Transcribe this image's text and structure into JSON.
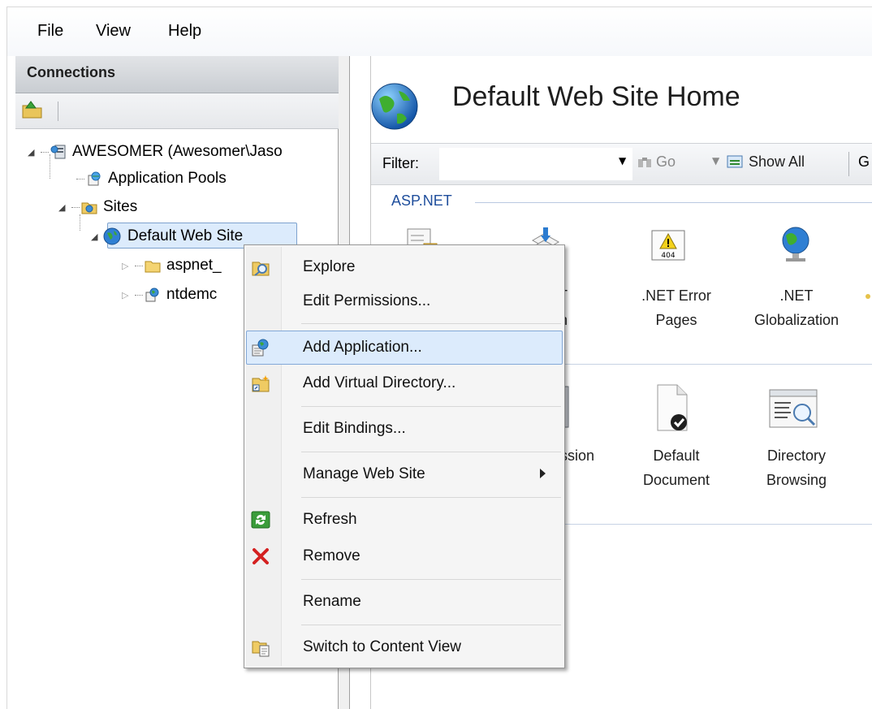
{
  "menubar": {
    "file": "File",
    "view": "View",
    "help": "Help"
  },
  "connections": {
    "header": "Connections",
    "tree": {
      "server": "AWESOMER (Awesomer\\Jaso",
      "app_pools": "Application Pools",
      "sites": "Sites",
      "default_site": "Default Web Site",
      "child1": "aspnet_",
      "child2": "ntdemc"
    }
  },
  "main": {
    "title": "Default Web Site Home",
    "filter": {
      "label": "Filter:",
      "go": "Go",
      "show_all": "Show All",
      "group_by": "G"
    },
    "group": "ASP.NET",
    "features_row1": [
      {
        "line1": "",
        "line2": ""
      },
      {
        "line1": "T",
        "line2": "ation"
      },
      {
        "line1": ".NET Error",
        "line2": "Pages"
      },
      {
        "line1": ".NET",
        "line2": "Globalization"
      }
    ],
    "features_row2": [
      {
        "line1": "ssion",
        "line2": ""
      },
      {
        "line1": "Default",
        "line2": "Document"
      },
      {
        "line1": "Directory",
        "line2": "Browsing"
      }
    ],
    "icon_404_text": "404"
  },
  "context_menu": {
    "explore": "Explore",
    "edit_permissions": "Edit Permissions...",
    "add_application": "Add Application...",
    "add_virtual_directory": "Add Virtual Directory...",
    "edit_bindings": "Edit Bindings...",
    "manage_web_site": "Manage Web Site",
    "refresh": "Refresh",
    "remove": "Remove",
    "rename": "Rename",
    "switch_content_view": "Switch to Content View"
  },
  "colors": {
    "selection": "#dcebfc",
    "selection_border": "#82a8d8",
    "group_label": "#1f4e9c"
  }
}
